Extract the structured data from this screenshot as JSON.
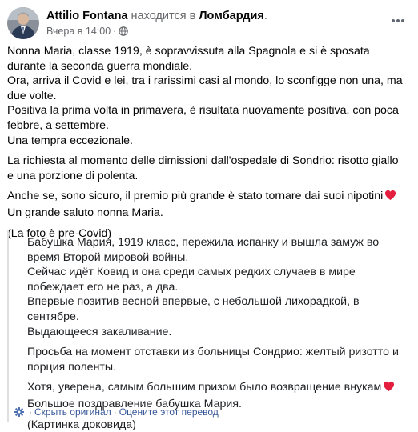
{
  "header": {
    "author": "Attilio Fontana",
    "action": "находится в",
    "place": "Ломбардия",
    "place_suffix": ".",
    "timestamp": "Вчера в 14:00",
    "separator": "·"
  },
  "post": {
    "paragraphs": [
      [
        "Nonna Maria, classe 1919, è sopravvissuta alla Spagnola e si è sposata durante la seconda guerra mondiale.",
        "Ora, arriva il Covid e lei, tra i rarissimi casi al mondo, lo sconfigge non una, ma due volte.",
        "Positiva la prima volta in primavera, è risultata nuovamente positiva, con poca febbre, a settembre.",
        "Una tempra eccezionale."
      ],
      [
        "La richiesta al momento delle dimissioni dall'ospedale di Sondrio: risotto giallo e una porzione di polenta."
      ],
      [
        "Anche se, sono sicuro, il premio più grande è stato tornare dai suoi nipotini",
        "Un grande saluto nonna Maria."
      ],
      [
        "(La foto è pre-Covid)"
      ]
    ]
  },
  "translation": {
    "paragraphs": [
      [
        "Бабушка Мария, 1919 класс, пережила испанку и вышла замуж во время Второй мировой войны.",
        "Сейчас идёт Ковид и она среди самых редких случаев в мире побеждает его не раз, а два.",
        "Впервые позитив весной впервые, с небольшой лихорадкой, в сентябре.",
        "Выдающееся закаливание."
      ],
      [
        "Просьба на момент отставки из больницы Сондрио: желтый ризотто и порция поленты."
      ],
      [
        "Хотя, уверена, самым большим призом было возвращение внукам",
        "Большое поздравление бабушка Мария."
      ],
      [
        "(Картинка доковида)"
      ]
    ],
    "hide_original": "Скрыть оригинал",
    "rate_translation": "Оцените этот перевод",
    "dot": "·"
  },
  "colors": {
    "link": "#385898",
    "secondary": "#65676b",
    "heart": "#e41e3f"
  },
  "icons": {
    "globe": "globe-icon",
    "more": "more-horizontal-icon",
    "heart": "red-heart-icon",
    "gear": "gear-icon"
  }
}
